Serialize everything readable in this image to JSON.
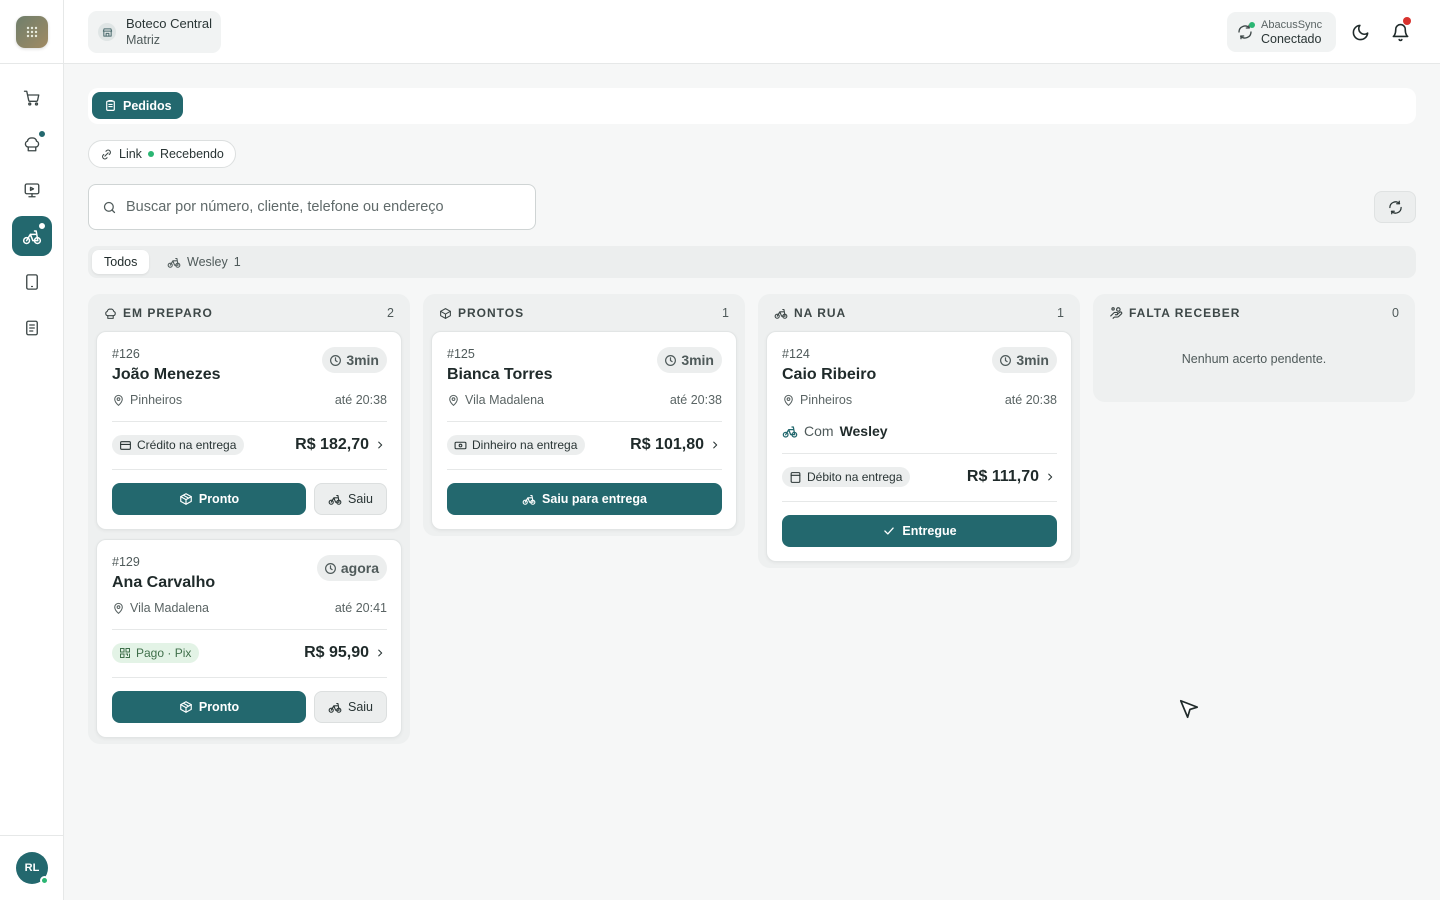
{
  "header": {
    "store_name": "Boteco Central",
    "store_branch": "Matriz",
    "sync_name": "AbacusSync",
    "sync_status": "Conectado"
  },
  "sidebar": {
    "items": [
      {
        "name": "cart-icon"
      },
      {
        "name": "chef-hat-icon"
      },
      {
        "name": "monitor-icon"
      },
      {
        "name": "bike-icon"
      },
      {
        "name": "tablet-icon"
      },
      {
        "name": "document-icon"
      }
    ],
    "avatar_initials": "RL"
  },
  "tabs": {
    "active": "Pedidos"
  },
  "link_chip": {
    "label": "Link",
    "status": "Recebendo"
  },
  "search": {
    "placeholder": "Buscar por número, cliente, telefone ou endereço",
    "value": ""
  },
  "filters": [
    {
      "label": "Todos",
      "count": ""
    },
    {
      "label": "Wesley",
      "count": "1"
    }
  ],
  "columns": [
    {
      "title": "EM PREPARO",
      "count": "2",
      "cards": [
        {
          "num": "#126",
          "name": "João Menezes",
          "time": "3min",
          "loc": "Pinheiros",
          "eta": "até 20:38",
          "pay": "Crédito na entrega",
          "price": "R$ 182,70",
          "primary": "Pronto",
          "secondary": "Saiu"
        },
        {
          "num": "#129",
          "name": "Ana Carvalho",
          "time": "agora",
          "loc": "Vila Madalena",
          "eta": "até 20:41",
          "pay": "Pago · Pix",
          "price": "R$ 95,90",
          "primary": "Pronto",
          "secondary": "Saiu"
        }
      ]
    },
    {
      "title": "PRONTOS",
      "count": "1",
      "cards": [
        {
          "num": "#125",
          "name": "Bianca Torres",
          "time": "3min",
          "loc": "Vila Madalena",
          "eta": "até 20:38",
          "pay": "Dinheiro na entrega",
          "price": "R$ 101,80",
          "primary": "Saiu para entrega"
        }
      ]
    },
    {
      "title": "NA RUA",
      "count": "1",
      "cards": [
        {
          "num": "#124",
          "name": "Caio Ribeiro",
          "time": "3min",
          "loc": "Pinheiros",
          "eta": "até 20:38",
          "rider_prefix": "Com",
          "rider": "Wesley",
          "pay": "Débito na entrega",
          "price": "R$ 111,70",
          "primary": "Entregue"
        }
      ]
    },
    {
      "title": "FALTA RECEBER",
      "count": "0",
      "empty": "Nenhum acerto pendente."
    }
  ],
  "colors": {
    "accent": "#23686e",
    "online": "#2bb673",
    "alert": "#d8322e"
  }
}
